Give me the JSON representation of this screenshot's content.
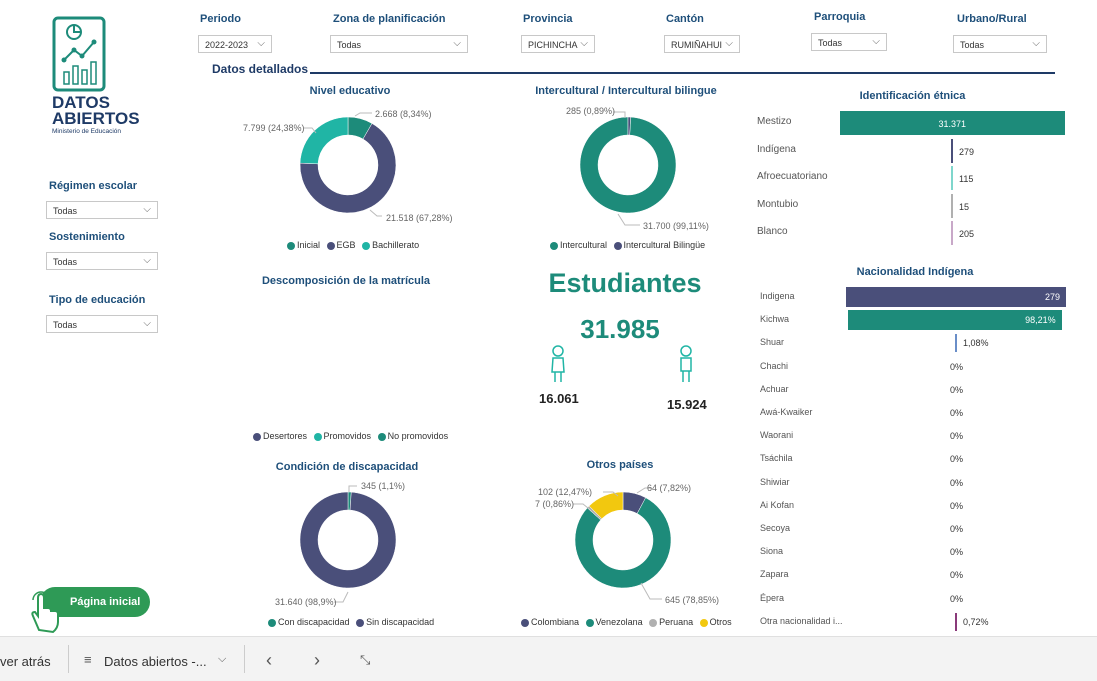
{
  "logo": {
    "line1": "DATOS",
    "line2": "ABIERTOS",
    "line3": "Ministerio de Educación"
  },
  "filters": [
    {
      "label": "Periodo",
      "value": "2022-2023"
    },
    {
      "label": "Zona de planificación",
      "value": "Todas"
    },
    {
      "label": "Provincia",
      "value": "PICHINCHA"
    },
    {
      "label": "Cantón",
      "value": "RUMIÑAHUI"
    },
    {
      "label": "Parroquia",
      "value": "Todas"
    },
    {
      "label": "Urbano/Rural",
      "value": "Todas"
    }
  ],
  "side_filters": [
    {
      "label": "Régimen escolar",
      "value": "Todas"
    },
    {
      "label": "Sostenimiento",
      "value": "Todas"
    },
    {
      "label": "Tipo de educación",
      "value": "Todas"
    }
  ],
  "section_title": "Datos detallados",
  "home_button": "Página inicial",
  "colors": {
    "dark": "#4a4f7a",
    "teal": "#1d8b7a",
    "aqua": "#20b5a5",
    "yellow": "#f2c80f",
    "gray": "#b0b0b0",
    "header": "#1e4f7a"
  },
  "chart_data": [
    {
      "type": "pie",
      "title": "Nivel educativo",
      "series": [
        {
          "name": "Inicial",
          "value": 2668,
          "label": "2.668 (8,34%)"
        },
        {
          "name": "EGB",
          "value": 21518,
          "label": "21.518 (67,28%)"
        },
        {
          "name": "Bachillerato",
          "value": 7799,
          "label": "7.799 (24,38%)"
        }
      ]
    },
    {
      "type": "pie",
      "title": "Intercultural / Intercultural bilingue",
      "series": [
        {
          "name": "Intercultural",
          "value": 31700,
          "label": "31.700 (99,11%)"
        },
        {
          "name": "Intercultural Bilingüe",
          "value": 285,
          "label": "285 (0,89%)"
        }
      ]
    },
    {
      "type": "pie",
      "title": "Descomposición de la matrícula",
      "series": [
        {
          "name": "Desertores"
        },
        {
          "name": "Promovidos"
        },
        {
          "name": "No promovidos"
        }
      ]
    },
    {
      "type": "pie",
      "title": "Condición de discapacidad",
      "series": [
        {
          "name": "Con discapacidad",
          "value": 345,
          "label": "345 (1,1%)"
        },
        {
          "name": "Sin discapacidad",
          "value": 31640,
          "label": "31.640 (98,9%)"
        }
      ]
    },
    {
      "type": "pie",
      "title": "Otros países",
      "series": [
        {
          "name": "Colombiana",
          "value": 64,
          "label": "64 (7,82%)"
        },
        {
          "name": "Venezolana",
          "value": 645,
          "label": "645 (78,85%)"
        },
        {
          "name": "Peruana",
          "value": 7,
          "label": "7 (0,86%)"
        },
        {
          "name": "Otros",
          "value": 102,
          "label": "102 (12,47%)"
        }
      ]
    },
    {
      "type": "bar",
      "title": "Identificación étnica",
      "categories": [
        "Mestizo",
        "Indígena",
        "Afroecuatoriano",
        "Montubio",
        "Blanco"
      ],
      "values": [
        31371,
        279,
        115,
        15,
        205
      ],
      "labels": [
        "31.371",
        "279",
        "115",
        "15",
        "205"
      ]
    },
    {
      "type": "bar",
      "title": "Nacionalidad Indígena",
      "categories": [
        "Indigena",
        "Kichwa",
        "Shuar",
        "Chachi",
        "Achuar",
        "Awá-Kwaiker",
        "Waorani",
        "Tsáchila",
        "Shiwiar",
        "Ai Kofan",
        "Secoya",
        "Siona",
        "Zapara",
        "Épera",
        "Otra nacionalidad i..."
      ],
      "values": [
        279,
        98.21,
        1.08,
        0,
        0,
        0,
        0,
        0,
        0,
        0,
        0,
        0,
        0,
        0,
        0.72
      ],
      "labels": [
        "279",
        "98,21%",
        "1,08%",
        "0%",
        "0%",
        "0%",
        "0%",
        "0%",
        "0%",
        "0%",
        "0%",
        "0%",
        "0%",
        "0%",
        "0,72%"
      ]
    }
  ],
  "students": {
    "title": "Estudiantes",
    "total": "31.985",
    "female": "16.061",
    "male": "15.924"
  },
  "taskbar": {
    "back": "ver atrás",
    "doc": "Datos abiertos -...",
    "prev": "‹",
    "next": "›",
    "collapse": "⤡"
  }
}
